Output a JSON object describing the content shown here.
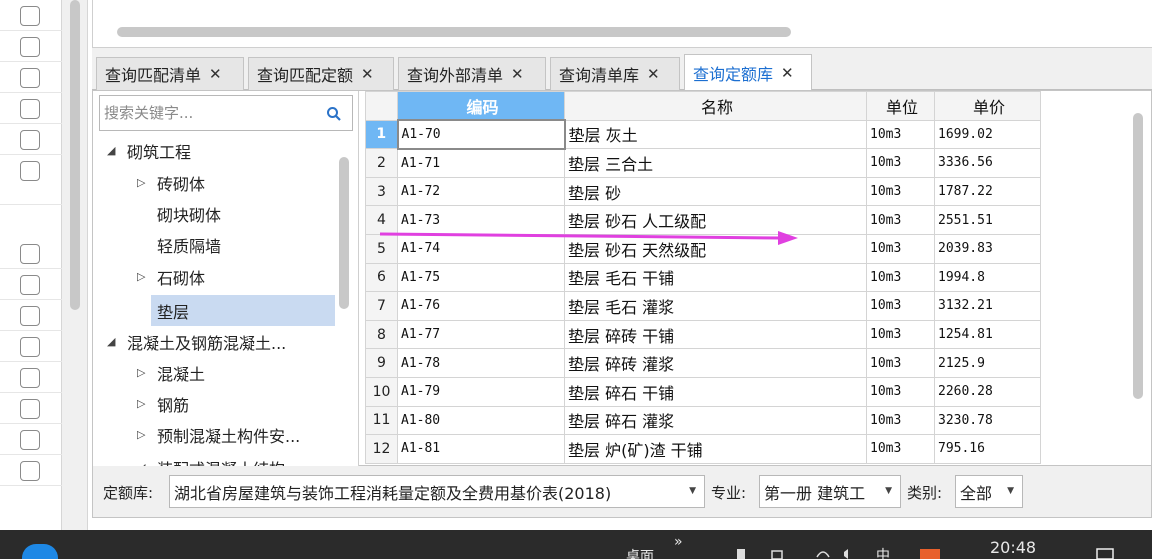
{
  "tabs": [
    {
      "label": "查询匹配清单",
      "close": "✕"
    },
    {
      "label": "查询匹配定额",
      "close": "✕"
    },
    {
      "label": "查询外部清单",
      "close": "✕"
    },
    {
      "label": "查询清单库",
      "close": "✕"
    },
    {
      "label": "查询定额库",
      "close": "✕"
    }
  ],
  "search": {
    "placeholder": "搜索关键字..."
  },
  "tree": [
    {
      "label": "砌筑工程",
      "arrow": "◢"
    },
    {
      "label": "砖砌体",
      "arrow": "▷"
    },
    {
      "label": "砌块砌体",
      "arrow": ""
    },
    {
      "label": "轻质隔墙",
      "arrow": ""
    },
    {
      "label": "石砌体",
      "arrow": "▷"
    },
    {
      "label": "垫层",
      "arrow": ""
    },
    {
      "label": "混凝土及钢筋混凝土...",
      "arrow": "◢"
    },
    {
      "label": "混凝土",
      "arrow": "▷"
    },
    {
      "label": "钢筋",
      "arrow": "▷"
    },
    {
      "label": "预制混凝土构件安...",
      "arrow": "▷"
    },
    {
      "label": "装配式混凝土结构...",
      "arrow": "◢"
    }
  ],
  "grid": {
    "headers": [
      "编码",
      "名称",
      "单位",
      "单价"
    ],
    "rows": [
      {
        "n": "1",
        "code": "A1-70",
        "name": "垫层 灰土",
        "unit": "10m3",
        "price": "1699.02"
      },
      {
        "n": "2",
        "code": "A1-71",
        "name": "垫层 三合土",
        "unit": "10m3",
        "price": "3336.56"
      },
      {
        "n": "3",
        "code": "A1-72",
        "name": "垫层 砂",
        "unit": "10m3",
        "price": "1787.22"
      },
      {
        "n": "4",
        "code": "A1-73",
        "name": "垫层 砂石 人工级配",
        "unit": "10m3",
        "price": "2551.51"
      },
      {
        "n": "5",
        "code": "A1-74",
        "name": "垫层 砂石 天然级配",
        "unit": "10m3",
        "price": "2039.83"
      },
      {
        "n": "6",
        "code": "A1-75",
        "name": "垫层 毛石 干铺",
        "unit": "10m3",
        "price": "1994.8"
      },
      {
        "n": "7",
        "code": "A1-76",
        "name": "垫层 毛石 灌浆",
        "unit": "10m3",
        "price": "3132.21"
      },
      {
        "n": "8",
        "code": "A1-77",
        "name": "垫层 碎砖 干铺",
        "unit": "10m3",
        "price": "1254.81"
      },
      {
        "n": "9",
        "code": "A1-78",
        "name": "垫层 碎砖 灌浆",
        "unit": "10m3",
        "price": "2125.9"
      },
      {
        "n": "10",
        "code": "A1-79",
        "name": "垫层 碎石 干铺",
        "unit": "10m3",
        "price": "2260.28"
      },
      {
        "n": "11",
        "code": "A1-80",
        "name": "垫层 碎石 灌浆",
        "unit": "10m3",
        "price": "3230.78"
      },
      {
        "n": "12",
        "code": "A1-81",
        "name": "垫层 炉(矿)渣 干铺",
        "unit": "10m3",
        "price": "795.16"
      }
    ]
  },
  "filters": {
    "library_label": "定额库:",
    "library_value": "湖北省房屋建筑与装饰工程消耗量定额及全费用基价表(2018)",
    "major_label": "专业:",
    "major_value": "第一册 建筑工",
    "category_label": "类别:",
    "category_value": "全部"
  },
  "taskbar": {
    "desktop": "桌面",
    "chevrons": "»",
    "ime": "中",
    "time": "20:48"
  },
  "colors": {
    "active_tab_text": "#1c6fd1",
    "header_highlight": "#6fb7f4",
    "tree_selection": "#c9daf1",
    "arrow_annotation": "#e040e0"
  }
}
